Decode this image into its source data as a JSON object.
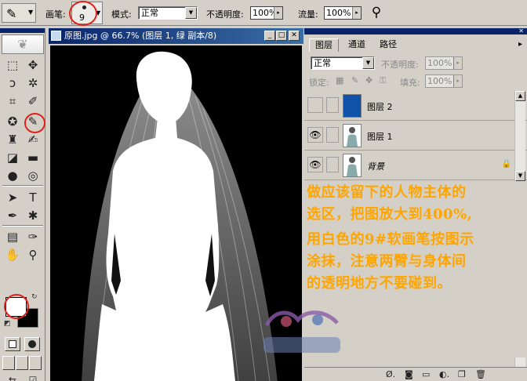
{
  "options_bar": {
    "brush_label": "画笔:",
    "brush_size": "9",
    "mode_label": "模式:",
    "mode_value": "正常",
    "opacity_label": "不透明度:",
    "opacity_value": "100%",
    "flow_label": "流量:",
    "flow_value": "100%"
  },
  "document": {
    "title": "原图.jpg @ 66.7% (图层 1, 绿 副本/8)"
  },
  "layers_panel": {
    "tabs": [
      "图层",
      "通道",
      "路径"
    ],
    "blend_mode": "正常",
    "opacity_label": "不透明度:",
    "opacity_value": "100%",
    "lock_label": "锁定:",
    "fill_label": "填充:",
    "fill_value": "100%",
    "layers": [
      {
        "name": "图层 2",
        "thumb_color": "#1052a8"
      },
      {
        "name": "图层 1"
      },
      {
        "name": "背景"
      }
    ]
  },
  "annotation": {
    "lines": [
      "做应该留下的人物主体的",
      "选区，把图放大到400%,",
      "用白色的9#软画笔按图示",
      "涂抹，注意两臂与身体间",
      "的透明地方不要碰到。"
    ]
  },
  "colors": {
    "annotation_text": "#ffa500",
    "highlight_ring": "#e0201a",
    "title_bar": "#0a246a"
  }
}
